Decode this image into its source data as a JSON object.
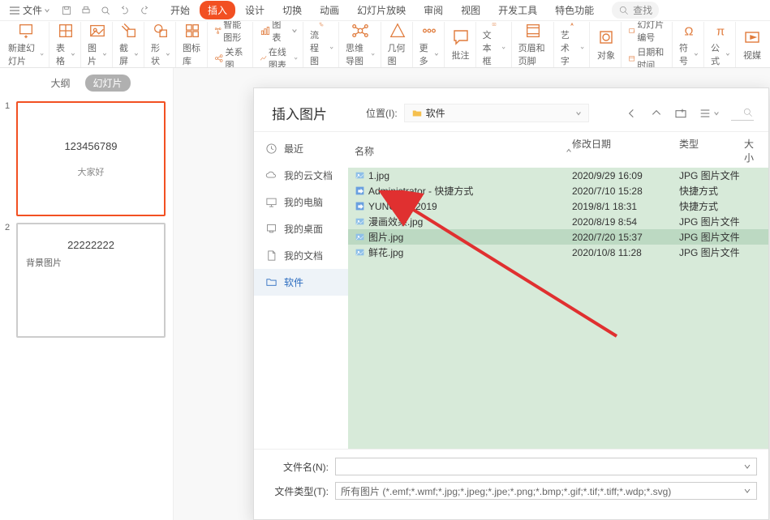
{
  "quick_access": {
    "file_label": "文件"
  },
  "menu_tabs": [
    "开始",
    "插入",
    "设计",
    "切换",
    "动画",
    "幻灯片放映",
    "审阅",
    "视图",
    "开发工具",
    "特色功能"
  ],
  "active_tab_index": 1,
  "search": {
    "placeholder": "查找"
  },
  "ribbon": {
    "new_slide": "新建幻灯片",
    "table": "表格",
    "picture": "图片",
    "screenshot": "截屏",
    "shapes": "形状",
    "icon_lib": "图标库",
    "smart_art_row": "智能图形",
    "chart_row": "图表",
    "relation": "关系图",
    "online_chart": "在线图表",
    "flowchart": "流程图",
    "mindmap": "思维导图",
    "geometry": "几何图",
    "more": "更多",
    "comment": "批注",
    "textbox": "文本框",
    "headerfooter": "页眉和页脚",
    "wordart": "艺术字",
    "object": "对象",
    "slidenum": "幻灯片编号",
    "datetime": "日期和时间",
    "symbol": "符号",
    "equation": "公式",
    "media": "视媒"
  },
  "panel": {
    "tab_outline": "大纲",
    "tab_slides": "幻灯片",
    "slide1_title": "123456789",
    "slide1_sub": "大家好",
    "slide2_title": "22222222",
    "slide2_caption": "背景图片"
  },
  "dialog": {
    "title": "插入图片",
    "location_label": "位置(I):",
    "location_value": "软件",
    "sidebar": {
      "recent": "最近",
      "cloud": "我的云文档",
      "computer": "我的电脑",
      "desktop": "我的桌面",
      "documents": "我的文档",
      "software": "软件"
    },
    "columns": {
      "name": "名称",
      "date": "修改日期",
      "type": "类型",
      "size": "大小"
    },
    "files": [
      {
        "name": "1.jpg",
        "date": "2020/9/29 16:09",
        "type": "JPG 图片文件",
        "icon": "img"
      },
      {
        "name": "Administrator - 快捷方式",
        "date": "2020/7/10 15:28",
        "type": "快捷方式",
        "icon": "shortcut"
      },
      {
        "name": "YUNQISHI2019",
        "date": "2019/8/1 18:31",
        "type": "快捷方式",
        "icon": "shortcut"
      },
      {
        "name": "漫画效果.jpg",
        "date": "2020/8/19 8:54",
        "type": "JPG 图片文件",
        "icon": "img"
      },
      {
        "name": "图片.jpg",
        "date": "2020/7/20 15:37",
        "type": "JPG 图片文件",
        "icon": "img",
        "selected": true
      },
      {
        "name": "鲜花.jpg",
        "date": "2020/10/8 11:28",
        "type": "JPG 图片文件",
        "icon": "img"
      }
    ],
    "filename_label": "文件名(N):",
    "filename_value": "",
    "filetype_label": "文件类型(T):",
    "filetype_value": "所有图片 (*.emf;*.wmf;*.jpg;*.jpeg;*.jpe;*.png;*.bmp;*.gif;*.tif;*.tiff;*.wdp;*.svg)"
  }
}
